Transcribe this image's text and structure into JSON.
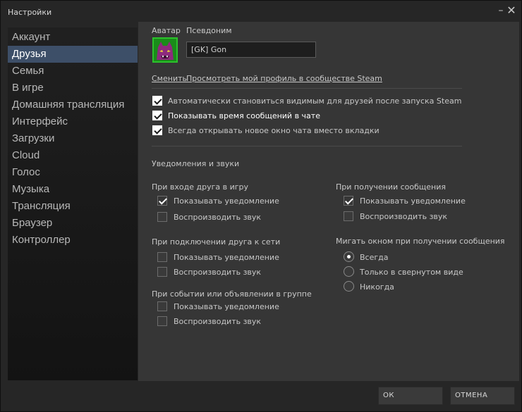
{
  "window": {
    "title": "Настройки"
  },
  "sidebar": {
    "items": [
      {
        "label": "Аккаунт"
      },
      {
        "label": "Друзья"
      },
      {
        "label": "Семья"
      },
      {
        "label": "В игре"
      },
      {
        "label": "Домашняя трансляция"
      },
      {
        "label": "Интерфейс"
      },
      {
        "label": "Загрузки"
      },
      {
        "label": "Cloud"
      },
      {
        "label": "Голос"
      },
      {
        "label": "Музыка"
      },
      {
        "label": "Трансляция"
      },
      {
        "label": "Браузер"
      },
      {
        "label": "Контроллер"
      }
    ],
    "active_index": 1
  },
  "profile": {
    "avatar_label": "Аватар",
    "nickname_label": "Псевдоним",
    "nickname_value": "[GK] Gon",
    "change_link": "Сменить",
    "view_profile_link": "Просмотреть мой профиль в сообществе Steam"
  },
  "options": [
    {
      "label": "Автоматически становиться видимым для друзей после запуска Steam",
      "checked": true
    },
    {
      "label": "Показывать время сообщений в чате",
      "checked": true
    },
    {
      "label": "Всегда открывать новое окно чата вместо вкладки",
      "checked": true
    }
  ],
  "notifications": {
    "section_title": "Уведомления и звуки",
    "friend_joins_game": {
      "title": "При входе друга в игру",
      "show_label": "Показывать уведомление",
      "show_checked": true,
      "sound_label": "Воспроизводить звук",
      "sound_checked": false
    },
    "friend_online": {
      "title": "При подключении друга к сети",
      "show_label": "Показывать уведомление",
      "show_checked": false,
      "sound_label": "Воспроизводить звук",
      "sound_checked": false
    },
    "group_event": {
      "title": "При событии или объявлении в группе",
      "show_label": "Показывать уведомление",
      "show_checked": false,
      "sound_label": "Воспроизводить звук",
      "sound_checked": false
    },
    "message_received": {
      "title": "При получении сообщения",
      "show_label": "Показывать уведомление",
      "show_checked": true,
      "sound_label": "Воспроизводить звук",
      "sound_checked": false
    },
    "flash_window": {
      "title": "Мигать окном при получении сообщения",
      "options": [
        {
          "label": "Всегда",
          "selected": true
        },
        {
          "label": "Только в свернутом виде",
          "selected": false
        },
        {
          "label": "Никогда",
          "selected": false
        }
      ]
    }
  },
  "buttons": {
    "ok": "ОК",
    "cancel": "ОТМЕНА"
  }
}
